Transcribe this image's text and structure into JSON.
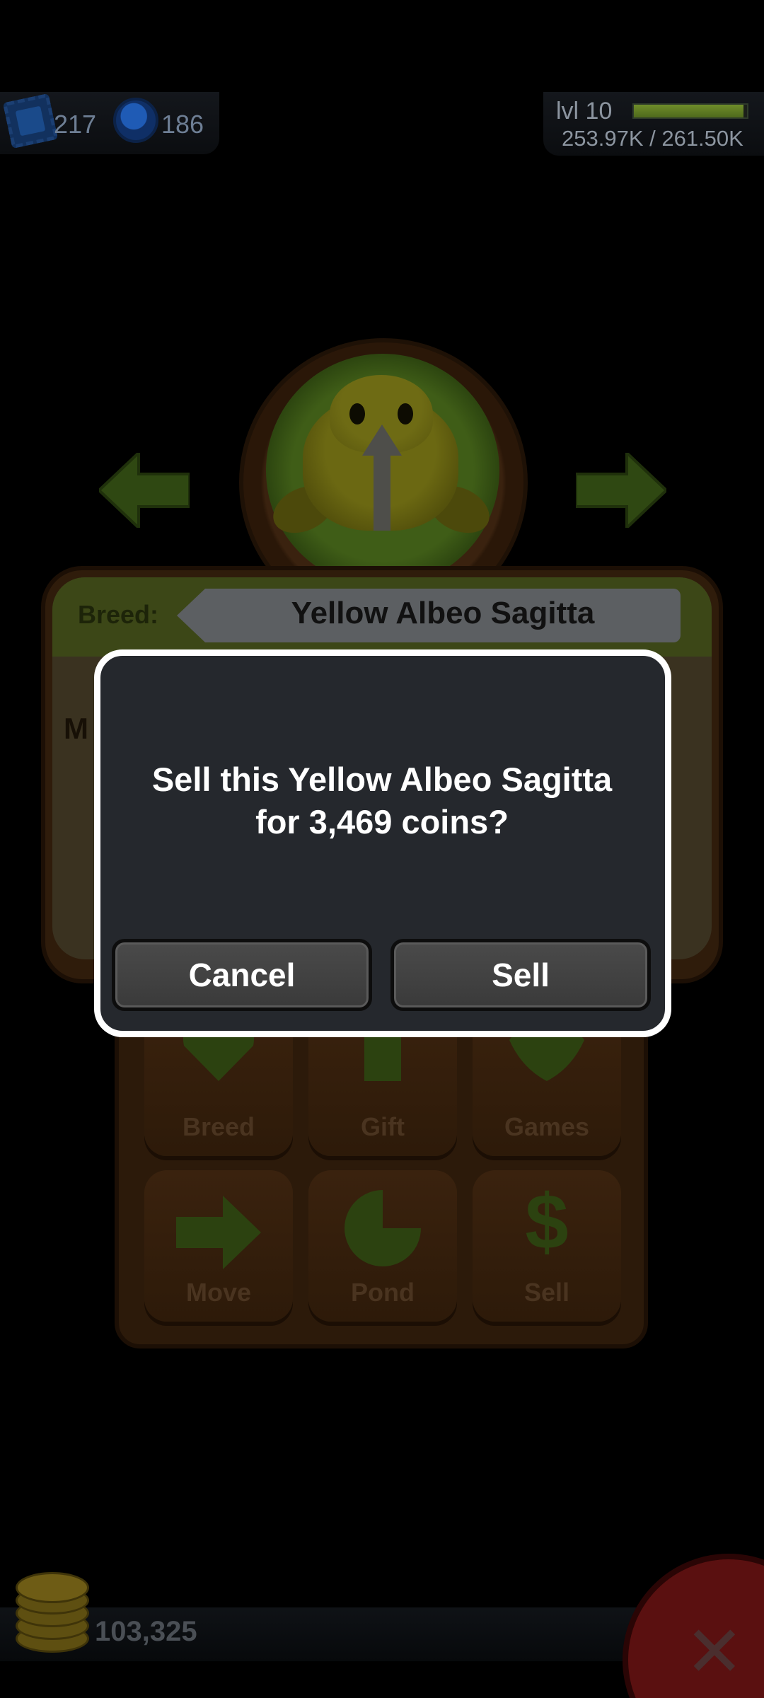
{
  "hud": {
    "stamps": "217",
    "gems": "186",
    "level_label": "lvl 10",
    "xp_text": "253.97K / 261.50K",
    "xp_fraction": 0.97
  },
  "frog": {
    "breed_label": "Breed:",
    "breed_name": "Yellow Albeo Sagitta",
    "colors": {
      "frog": "#6b6812",
      "pad": "#3f5d17"
    }
  },
  "panel_peek": {
    "left_text": "M"
  },
  "actions": [
    {
      "label": "Breed",
      "icon": "heart-icon"
    },
    {
      "label": "Gift",
      "icon": "gift-icon"
    },
    {
      "label": "Games",
      "icon": "spinning-top-icon"
    },
    {
      "label": "Move",
      "icon": "arrow-right-icon"
    },
    {
      "label": "Pond",
      "icon": "lily-pad-icon"
    },
    {
      "label": "Sell",
      "icon": "dollar-icon"
    }
  ],
  "bottom": {
    "coins": "103,325",
    "close_icon": "close-icon"
  },
  "dialog": {
    "message_line1": "Sell this Yellow Albeo Sagitta",
    "message_line2": "for 3,469 coins?",
    "cancel_label": "Cancel",
    "sell_label": "Sell"
  }
}
